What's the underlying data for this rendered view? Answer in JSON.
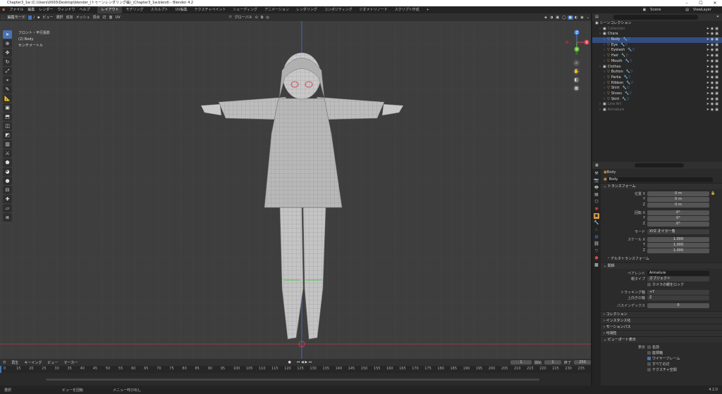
{
  "window": {
    "title": "Chapter3_1w (C:\\Users\\0000\\Desktop\\blender_(トゥーンレンダリング編)_\\Chapter3_1w.blend) - Blender 4.2",
    "controls": [
      "–",
      "☐",
      "✕"
    ]
  },
  "menubar": {
    "items": [
      "ファイル",
      "編集",
      "レンダー",
      "ウィンドウ",
      "ヘルプ"
    ],
    "workspaces": [
      "レイアウト",
      "モデリング",
      "スカルプト",
      "UV編集",
      "テクスチャペイント",
      "シェーディング",
      "アニメーション",
      "レンダリング",
      "コンポジティング",
      "ジオメトリノード",
      "スクリプト作成"
    ],
    "active_workspace": "レイアウト",
    "add": "+",
    "scene": "Scene",
    "view_layer": "ViewLayer"
  },
  "viewport_header": {
    "mode": "編集モード",
    "menus": [
      "ビュー",
      "選択",
      "追加",
      "メッシュ",
      "頂点",
      "辺",
      "面",
      "UV"
    ],
    "transform": "グローバル",
    "options": "オプション"
  },
  "viewport_info": {
    "line1": "フロント・平行投影",
    "line2": "(2) Body",
    "line3": "センチメートル"
  },
  "toolbar": {
    "icons": [
      "select-icon",
      "cursor-icon",
      "move-icon",
      "rotate-icon",
      "scale-icon",
      "transform-icon",
      "annotate-icon",
      "measure-icon",
      "add-cube-icon",
      "extrude-icon",
      "inset-icon",
      "bevel-icon",
      "loopcut-icon",
      "knife-icon",
      "polybuild-icon",
      "spin-icon",
      "smooth-icon",
      "edge-slide-icon",
      "shrink-icon",
      "shear-icon",
      "rip-icon"
    ]
  },
  "gizmo": {
    "x": "X",
    "y": "Y",
    "z": "Z"
  },
  "outliner": {
    "title": "シーンコレクション",
    "search": "",
    "rows": [
      {
        "name": "Collection",
        "indent": 1,
        "dim": true
      },
      {
        "name": "Chara",
        "indent": 1,
        "dim": false
      },
      {
        "name": "Body",
        "indent": 2,
        "dim": false,
        "selected": true
      },
      {
        "name": "Eye",
        "indent": 2,
        "dim": false
      },
      {
        "name": "Eyelash",
        "indent": 2,
        "dim": false
      },
      {
        "name": "Hair",
        "indent": 2,
        "dim": false
      },
      {
        "name": "Mouth",
        "indent": 2,
        "dim": false
      },
      {
        "name": "Clothes",
        "indent": 1,
        "dim": false
      },
      {
        "name": "Button",
        "indent": 2,
        "dim": false
      },
      {
        "name": "Parka",
        "indent": 2,
        "dim": false
      },
      {
        "name": "Ribbon",
        "indent": 2,
        "dim": false
      },
      {
        "name": "Shirt",
        "indent": 2,
        "dim": false
      },
      {
        "name": "Shoes",
        "indent": 2,
        "dim": false
      },
      {
        "name": "Skirt",
        "indent": 2,
        "dim": false
      },
      {
        "name": "Line Art",
        "indent": 1,
        "dim": true
      },
      {
        "name": "Armature",
        "indent": 1,
        "dim": true
      }
    ]
  },
  "properties": {
    "object": "Body",
    "object_field": "Body",
    "sections": {
      "transform": "トランスフォーム",
      "delta": "デルタトランスフォーム",
      "relations": "関係",
      "collections": "コレクション",
      "instancing": "インスタンス化",
      "motion": "モーションパス",
      "visibility": "可視性",
      "viewport_display": "ビューポート表示"
    },
    "location": {
      "label": "位置 X",
      "x": "0 m",
      "y": "0 m",
      "z": "0 m"
    },
    "rotation": {
      "label": "回転 X",
      "x": "0°",
      "y": "0°",
      "z": "0°"
    },
    "mode": {
      "label": "モード",
      "value": "XYZ オイラー角"
    },
    "scale": {
      "label": "スケール X",
      "x": "1.000",
      "y": "1.000",
      "z": "1.000"
    },
    "axis": {
      "y": "Y",
      "z": "Z"
    },
    "parent": {
      "label": "ペアレント",
      "value": "Armature"
    },
    "parent_type": {
      "label": "親タイプ",
      "value": "オブジェクト"
    },
    "camera_lock": "カメラの親をロック",
    "track_axis": {
      "label": "トラッキング軸",
      "value": "+Y"
    },
    "up_axis": {
      "label": "上向きの軸",
      "value": "Z"
    },
    "pass_index": {
      "label": "パスインデックス",
      "value": "0"
    },
    "display": {
      "label": "表示",
      "name": "名前",
      "axes": "座標軸",
      "wireframe": "ワイヤーフレーム",
      "all_edges": "すべての辺",
      "texture_space": "テクスチャ空間"
    }
  },
  "timeline": {
    "playback": "再生",
    "keying": "キーイング",
    "view": "ビュー",
    "marker": "マーカー",
    "current": "1",
    "start_label": "開始",
    "start": "1",
    "end_label": "終了",
    "end": "250",
    "ticks": [
      "0",
      "15",
      "20",
      "25",
      "30",
      "35",
      "40",
      "45",
      "50",
      "55",
      "60",
      "65",
      "70",
      "75",
      "80",
      "85",
      "90",
      "95",
      "100",
      "105",
      "110",
      "115",
      "120",
      "125",
      "130",
      "135",
      "140",
      "145",
      "150",
      "155",
      "160",
      "165",
      "170",
      "175",
      "180",
      "185",
      "190",
      "195",
      "200",
      "205",
      "210",
      "215",
      "220",
      "225",
      "230",
      "235"
    ]
  },
  "status": {
    "select": "選択",
    "rotate": "ビューを回転",
    "menu": "メニュー呼び出し",
    "version": "4.2.0"
  },
  "colors": {
    "accent": "#4772b3",
    "selected_row": "#334d80",
    "viewport": "#3e3e3e",
    "mesh": "#cfcfcf",
    "x_axis": "#e04050",
    "y_axis": "#6abf3a",
    "z_axis": "#4a8ae0"
  }
}
